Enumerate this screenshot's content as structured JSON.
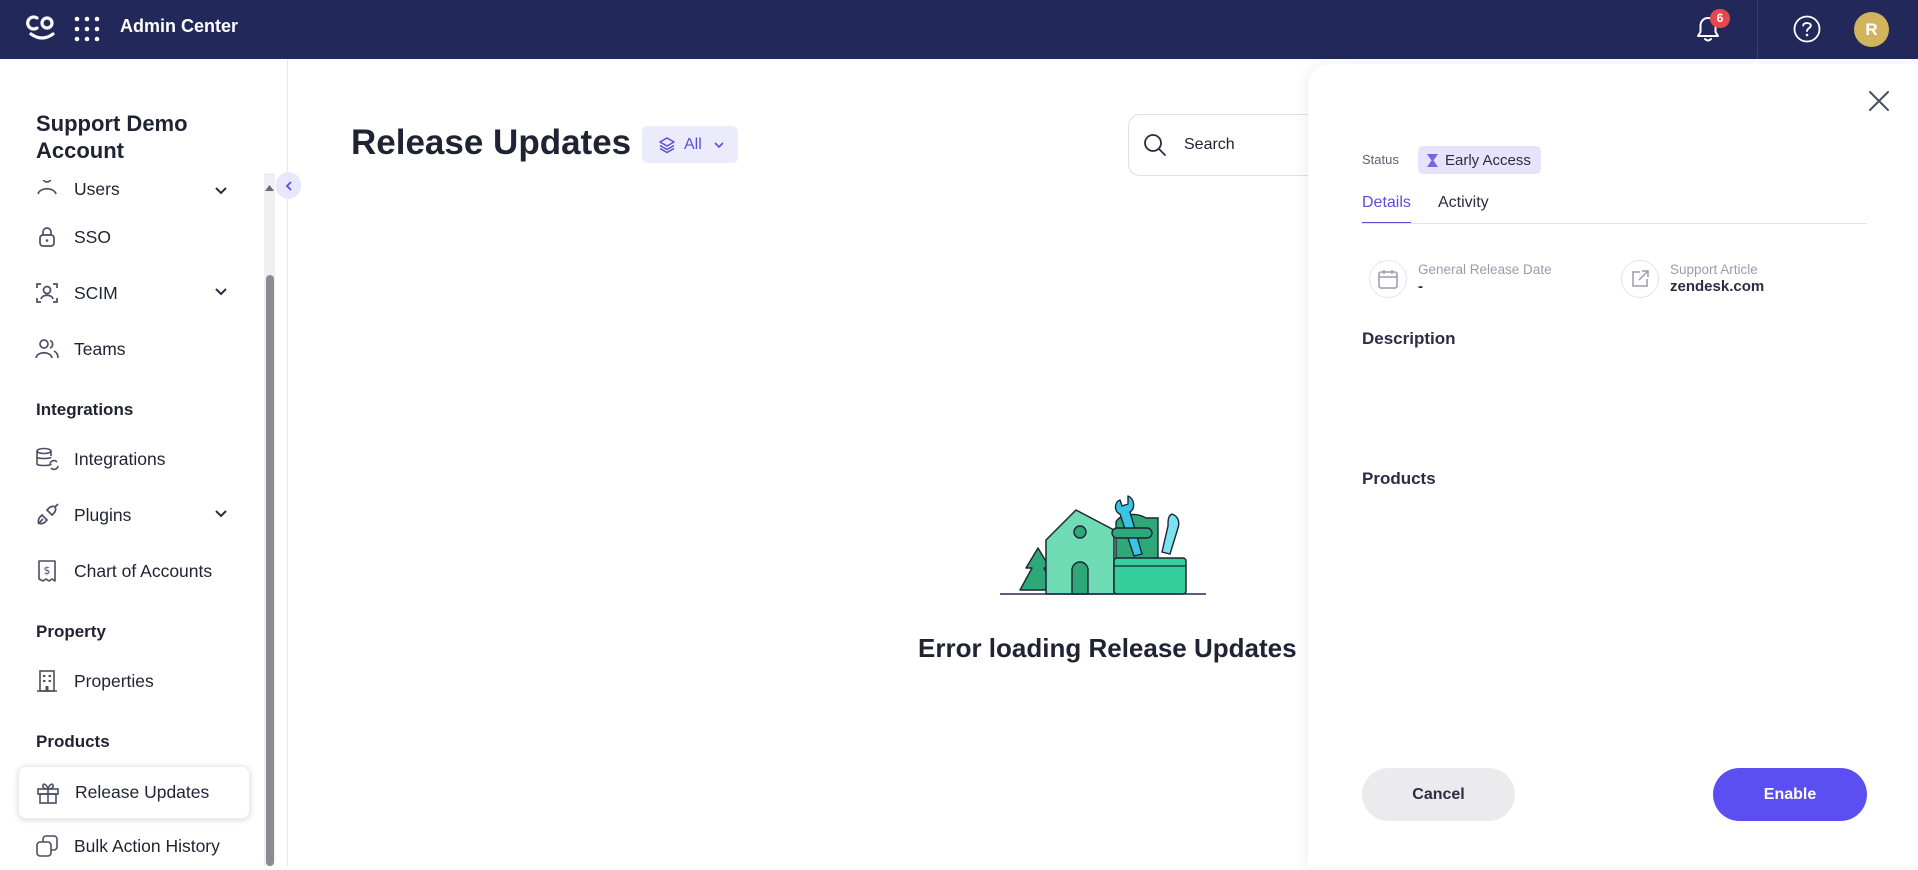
{
  "topbar": {
    "app_title": "Admin Center",
    "notification_count": "6",
    "user_initial": "R"
  },
  "sidebar": {
    "account_name": "Support Demo Account",
    "items": [
      {
        "label": "Users"
      },
      {
        "label": "SSO"
      },
      {
        "label": "SCIM"
      },
      {
        "label": "Teams"
      },
      {
        "label": "Integrations"
      },
      {
        "label": "Plugins"
      },
      {
        "label": "Chart of Accounts"
      },
      {
        "label": "Properties"
      },
      {
        "label": "Release Updates"
      },
      {
        "label": "Bulk Action History"
      }
    ],
    "sections": {
      "integrations": "Integrations",
      "property": "Property",
      "products": "Products"
    }
  },
  "main": {
    "title": "Release Updates",
    "filter_label": "All",
    "search_placeholder": "Search",
    "error_message": "Error loading Release Updates"
  },
  "drawer": {
    "status_label": "Status",
    "status_value": "Early Access",
    "tabs": [
      {
        "label": "Details"
      },
      {
        "label": "Activity"
      }
    ],
    "general_release_label": "General Release Date",
    "general_release_value": "-",
    "support_article_label": "Support Article",
    "support_article_value": "zendesk.com",
    "description_heading": "Description",
    "products_heading": "Products",
    "cancel_label": "Cancel",
    "enable_label": "Enable"
  },
  "colors": {
    "topbar_bg": "#23285a",
    "accent": "#5b4ff2",
    "badge_red": "#e5484d",
    "avatar": "#d2b45e"
  }
}
